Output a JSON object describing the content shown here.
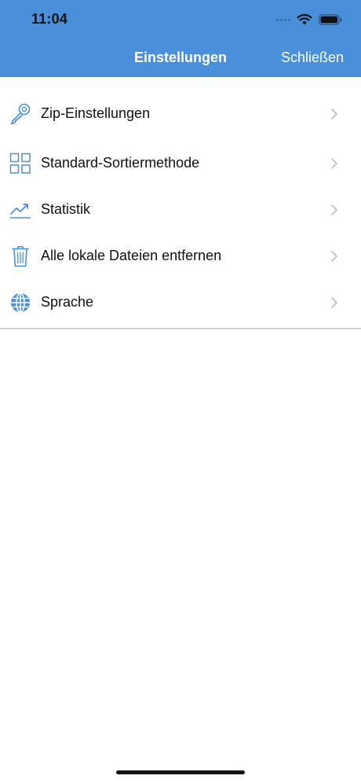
{
  "status_bar": {
    "time": "11:04"
  },
  "nav": {
    "title": "Einstellungen",
    "close_label": "Schließen"
  },
  "colors": {
    "header_bg": "#4a8fd9",
    "icon": "#4a8fd9",
    "chevron": "#c7c7cc"
  },
  "settings": {
    "items": [
      {
        "label": "Zip-Einstellungen",
        "icon": "key-icon"
      },
      {
        "label": "Standard-Sortiermethode",
        "icon": "grid-icon"
      },
      {
        "label": "Statistik",
        "icon": "chart-line-icon"
      },
      {
        "label": "Alle lokale Dateien entfernen",
        "icon": "trash-icon"
      },
      {
        "label": "Sprache",
        "icon": "globe-icon"
      }
    ]
  }
}
